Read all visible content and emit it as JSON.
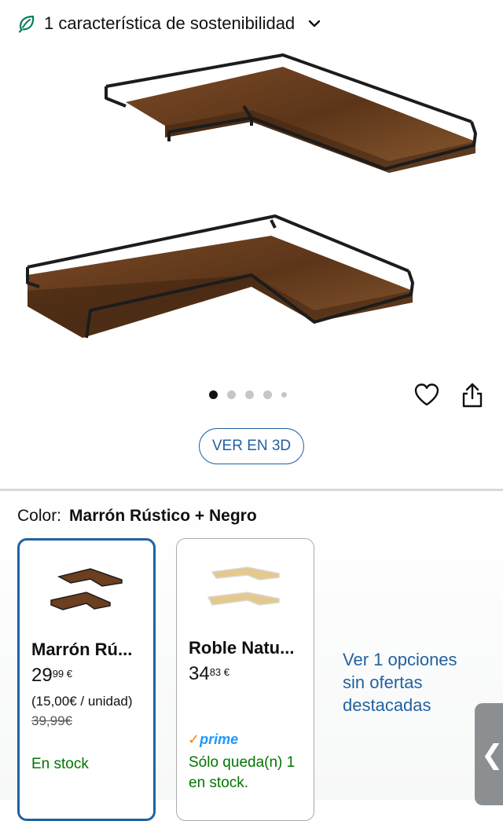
{
  "sustainability": {
    "text": "1 característica de sostenibilidad",
    "icon": "leaf-icon",
    "chevron": "chevron-down-icon"
  },
  "gallery": {
    "dots_total": 5,
    "active_index": 0,
    "view3d_label": "VER EN 3D"
  },
  "actions": {
    "favorite_icon": "heart-icon",
    "share_icon": "share-icon"
  },
  "color": {
    "label": "Color:",
    "selected": "Marrón Rústico + Negro"
  },
  "variants": [
    {
      "name": "Marrón Rú...",
      "price_whole": "29",
      "price_fraction": "99",
      "currency": "€",
      "unit_price": "(15,00€ / unidad)",
      "old_price": "39,99€",
      "stock": "En stock"
    },
    {
      "name": "Roble Natu...",
      "price_whole": "34",
      "price_fraction": "83",
      "currency": "€",
      "prime_check": "✓",
      "prime_label": "prime",
      "stock": "Sólo queda(n) 1 en stock."
    }
  ],
  "more_options": "Ver 1 opciones sin ofertas destacadas",
  "side_tab_arrow": "❮",
  "colors": {
    "accent": "#2162a1",
    "in_stock": "#007600",
    "prime_blue": "#1a98ff",
    "leaf_green": "#067d62"
  }
}
